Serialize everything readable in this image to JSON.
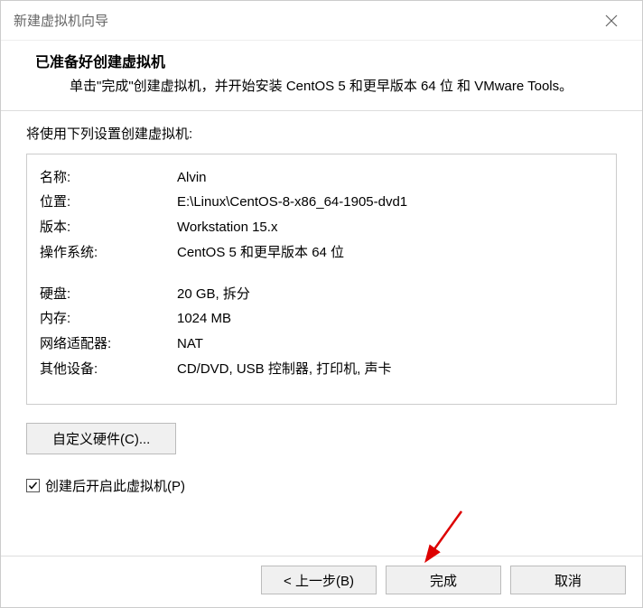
{
  "window": {
    "title": "新建虚拟机向导"
  },
  "header": {
    "title": "已准备好创建虚拟机",
    "desc": "单击\"完成\"创建虚拟机，并开始安装 CentOS 5 和更早版本 64 位 和 VMware Tools。"
  },
  "body": {
    "intro": "将使用下列设置创建虚拟机:",
    "settings": {
      "group1": [
        {
          "label": "名称:",
          "value": "Alvin"
        },
        {
          "label": "位置:",
          "value": "E:\\Linux\\CentOS-8-x86_64-1905-dvd1"
        },
        {
          "label": "版本:",
          "value": "Workstation 15.x"
        },
        {
          "label": "操作系统:",
          "value": "CentOS 5 和更早版本 64 位"
        }
      ],
      "group2": [
        {
          "label": "硬盘:",
          "value": "20 GB, 拆分"
        },
        {
          "label": "内存:",
          "value": "1024 MB"
        },
        {
          "label": "网络适配器:",
          "value": "NAT"
        },
        {
          "label": "其他设备:",
          "value": "CD/DVD, USB 控制器, 打印机, 声卡"
        }
      ]
    },
    "customize_button": "自定义硬件(C)...",
    "checkbox_label": "创建后开启此虚拟机(P)"
  },
  "footer": {
    "back": "< 上一步(B)",
    "finish": "完成",
    "cancel": "取消"
  }
}
